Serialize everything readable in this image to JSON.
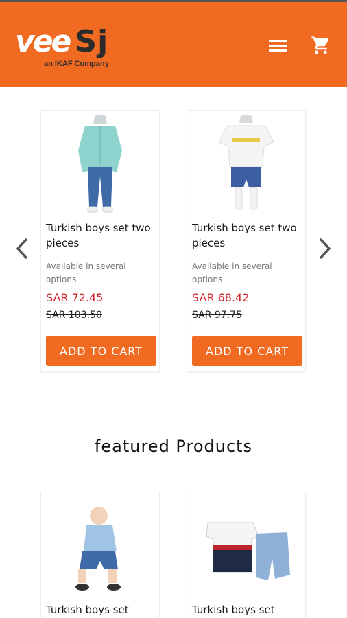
{
  "header": {
    "logo_text": "ee",
    "logo_prefix": "v",
    "logo_suffix": "Sj",
    "logo_tagline": "an IKAF Company",
    "menu_icon": "hamburger-menu-icon",
    "cart_icon": "shopping-cart-icon",
    "brand_color": "#f06a22"
  },
  "carousel": {
    "prev_icon": "chevron-left-icon",
    "next_icon": "chevron-right-icon",
    "products": [
      {
        "title": "Turkish boys set two pieces",
        "subtitle": "Available in several options",
        "price": "SAR 72.45",
        "old_price": "SAR 103.50",
        "button": "ADD TO CART"
      },
      {
        "title": "Turkish boys set two pieces",
        "subtitle": "Available in several options",
        "price": "SAR 68.42",
        "old_price": "SAR 97.75",
        "button": "ADD TO CART"
      }
    ]
  },
  "featured": {
    "title": "featured Products",
    "products": [
      {
        "title": "Turkish boys set"
      },
      {
        "title": "Turkish boys set"
      }
    ]
  },
  "colors": {
    "accent": "#f06a22",
    "price": "#d0202c"
  }
}
